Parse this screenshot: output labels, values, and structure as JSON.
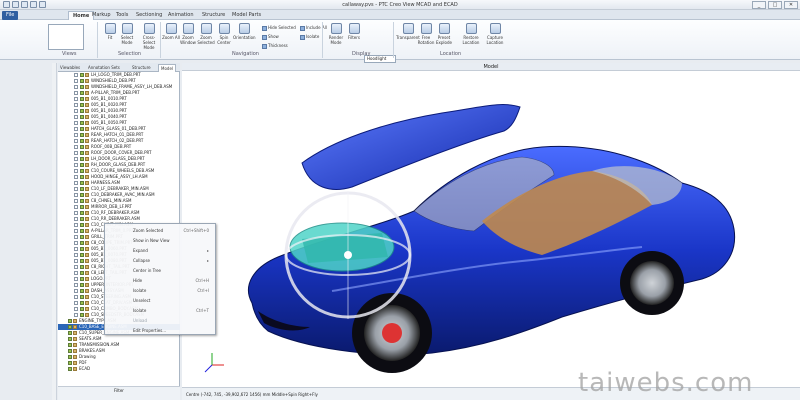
{
  "window": {
    "title": "callaway.pvs - PTC Creo View MCAD and ECAD",
    "controls": [
      "_",
      "□",
      "✕"
    ]
  },
  "tabs": [
    {
      "label": "File",
      "kind": "file"
    },
    {
      "label": "Home",
      "kind": "active"
    },
    {
      "label": "Markup",
      "kind": ""
    },
    {
      "label": "Tools",
      "kind": ""
    },
    {
      "label": "Sectioning",
      "kind": ""
    },
    {
      "label": "Animation",
      "kind": ""
    },
    {
      "label": "Structure",
      "kind": ""
    },
    {
      "label": "Model Parts",
      "kind": ""
    }
  ],
  "ribbon": {
    "buttons": [
      "Fit",
      "Select Mode",
      "Cross-Select Mode",
      "Zoom All",
      "Zoom Window",
      "Zoom Selected",
      "Spin Center",
      "Orientation",
      "Render Mode",
      "Filters",
      "Transparent",
      "Free Rotation",
      "Preset Explode",
      "Restore Location",
      "Capture Location"
    ],
    "small": [
      "Hide Selected",
      "Show",
      "Thickness",
      "Include All",
      "Isolate"
    ],
    "dropdown": "Hoodlight",
    "groups": [
      "Views",
      "Selection",
      "Navigation",
      "Display",
      "Location"
    ]
  },
  "panel": {
    "tabs": [
      "Viewables",
      "Annotation Sets",
      "Structure",
      "Model"
    ],
    "tree": [
      "LH_LOGO_TRIM_DEB.PRT",
      "WINDSHIELD_DEB.PRT",
      "WINDSHIELD_FRAME_ASSY_LH_DEB.ASM",
      "A-PILLAR_TRIM_DEB.PRT",
      "005_B1_0010.PRT",
      "005_B1_0020.PRT",
      "005_B1_0030.PRT",
      "005_B1_0040.PRT",
      "005_B1_0050.PRT",
      "HATCH_GLASS_01_DEB.PRT",
      "REAR_HATCH_01_DEB.PRT",
      "REAR_HATCH_02_DEB.PRT",
      "ROOF_00B_DEB.PRT",
      "ROOF_DOOR_COVER_DEB.PRT",
      "LH_DOOR_GLASS_DEB.PRT",
      "RH_DOOR_GLASS_DEB.PRT",
      "C10_COURE_WHEELS_DEB.ASM",
      "HOOD_HINGE_ASSY_LH.ASM",
      "HARNESS.ASM",
      "C10_LF_DEBRAKER_MIN.ASM",
      "C10_DEBRAKER_AVAC_MIN.ASM",
      "C8_CHNEL_MIN.ASM",
      "MIRROR_DEB_LF.PRT",
      "C10_RF_DEBRAKER.ASM",
      "C10_RR_DEBRAKER.ASM",
      "C10_CHINT_MIN.ASM",
      "A-PILLAR_TRIM_0.PRT",
      "GRILL_TRIM.PRT",
      "C8_COUPE_TRIM.PRT",
      "005_B1_0060.PRT",
      "005_B1_0070.PRT",
      "005_B1_0080.PRT",
      "C8_RIGHT_TAIL.PRT",
      "C8_LEFT_TAIL.PRT",
      "LOGO.PRT",
      "UPPER_INTERIOR.PRT",
      "DASH_ASSY.ASM",
      "C10_STEERING.ASM",
      "C10_CLAT_DRIV.ASM",
      "C10_CAMBO_BODY.ASM",
      "C10_SPEEDSTR_BODY.ASM"
    ],
    "roots": [
      {
        "label": "ENGINE_TYPE.ASM",
        "sel": false
      },
      {
        "label": "C10_BASE_ENGINE.ASM",
        "sel": true
      },
      {
        "label": "C10_SUPER_ENGINE.ASM",
        "sel": false
      },
      {
        "label": "SEATS.ASM",
        "sel": false
      },
      {
        "label": "TRANSMISSION.ASM",
        "sel": false
      },
      {
        "label": "BRAKES.ASM",
        "sel": false
      },
      {
        "label": "Drawing",
        "sel": false
      },
      {
        "label": "PDF",
        "sel": false
      },
      {
        "label": "ECAD",
        "sel": false
      }
    ],
    "filter_label": "Filter"
  },
  "viewport": {
    "header": "Model"
  },
  "context_menu": [
    {
      "label": "Zoom Selected",
      "shortcut": "Ctrl+Shift+0",
      "disabled": false
    },
    {
      "label": "Show in New View",
      "shortcut": "",
      "disabled": false
    },
    {
      "label": "Expand",
      "shortcut": "▸",
      "disabled": false
    },
    {
      "label": "Collapse",
      "shortcut": "▸",
      "disabled": false
    },
    {
      "label": "Center in Tree",
      "shortcut": "",
      "disabled": false
    },
    {
      "label": "Hide",
      "shortcut": "Ctrl+H",
      "disabled": false
    },
    {
      "label": "Isolate",
      "shortcut": "Ctrl+I",
      "disabled": false
    },
    {
      "label": "Unselect",
      "shortcut": "",
      "disabled": false
    },
    {
      "label": "Isolate",
      "shortcut": "Ctrl+T",
      "disabled": false
    },
    {
      "label": "Unload",
      "shortcut": "",
      "disabled": true
    },
    {
      "label": "Edit Properties...",
      "shortcut": "",
      "disabled": false
    }
  ],
  "status": {
    "text": "Centre (-742, 745, -39,902,672 1456) mm    Middle+Spin    Right+Fly"
  },
  "watermark": "taiwebs.com",
  "colors": {
    "accent": "#2e5ea0",
    "car_body": "#1a36c8",
    "engine": "#4fd4c8"
  }
}
